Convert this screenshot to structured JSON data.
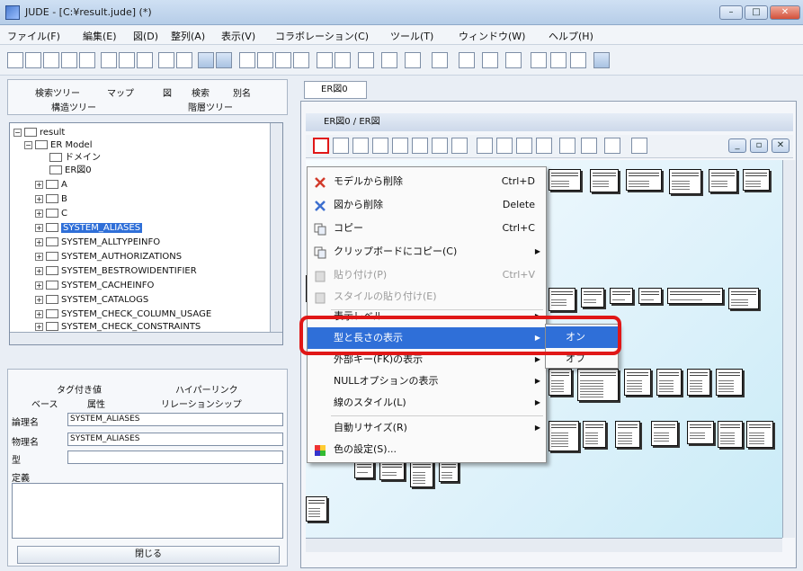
{
  "window": {
    "title": "JUDE - [C:¥result.jude] (*)"
  },
  "menubar": [
    "ファイル(F)",
    "編集(E)",
    "図(D)",
    "整列(A)",
    "表示(V)",
    "コラボレーション(C)",
    "ツール(T)",
    "ウィンドウ(W)",
    "ヘルプ(H)"
  ],
  "left_tabs": {
    "row1": [
      "検索ツリー",
      "マップ",
      "図",
      "検索",
      "別名"
    ],
    "row2": [
      "構造ツリー",
      "階層ツリー"
    ]
  },
  "tree": {
    "root": "result",
    "model": "ER Model",
    "domain": "ドメイン",
    "diagram": "ER図0",
    "items": [
      "A",
      "B",
      "C",
      "SYSTEM_ALIASES",
      "SYSTEM_ALLTYPEINFO",
      "SYSTEM_AUTHORIZATIONS",
      "SYSTEM_BESTROWIDENTIFIER",
      "SYSTEM_CACHEINFO",
      "SYSTEM_CATALOGS",
      "SYSTEM_CHECK_COLUMN_USAGE",
      "SYSTEM_CHECK_CONSTRAINTS"
    ]
  },
  "props": {
    "tabs_row1": [
      "タグ付き値",
      "ハイパーリンク"
    ],
    "tabs_row2": [
      "ベース",
      "属性",
      "リレーションシップ"
    ],
    "logical_name_label": "論理名",
    "logical_name_value": "SYSTEM_ALIASES",
    "physical_name_label": "物理名",
    "physical_name_value": "SYSTEM_ALIASES",
    "type_label": "型",
    "definition_label": "定義",
    "close_label": "閉じる"
  },
  "diagram": {
    "tab_label": "ER図0",
    "inner_title": "ER図0 / ER図"
  },
  "context_menu": [
    {
      "label": "モデルから削除",
      "shortcut": "Ctrl+D",
      "icon": "delete-model-icon"
    },
    {
      "label": "図から削除",
      "shortcut": "Delete",
      "icon": "delete-diagram-icon"
    },
    {
      "label": "コピー",
      "shortcut": "Ctrl+C",
      "icon": "copy-icon"
    },
    {
      "label": "クリップボードにコピー(C)",
      "shortcut": "",
      "icon": "clipboard-icon"
    },
    {
      "label": "貼り付け(P)",
      "shortcut": "Ctrl+V",
      "icon": "paste-icon"
    },
    {
      "label": "スタイルの貼り付け(E)",
      "shortcut": "",
      "icon": "paste-style-icon"
    },
    {
      "label": "表示レベル",
      "shortcut": "",
      "icon": ""
    },
    {
      "label": "型と長さの表示",
      "shortcut": "",
      "icon": ""
    },
    {
      "label": "外部キー(FK)の表示",
      "shortcut": "",
      "icon": ""
    },
    {
      "label": "NULLオプションの表示",
      "shortcut": "",
      "icon": ""
    },
    {
      "label": "線のスタイル(L)",
      "shortcut": "",
      "icon": ""
    },
    {
      "label": "自動リサイズ(R)",
      "shortcut": "",
      "icon": ""
    },
    {
      "label": "色の設定(S)...",
      "shortcut": "",
      "icon": "color-icon"
    }
  ],
  "submenu": [
    "オン",
    "オフ"
  ],
  "colors": {
    "highlight": "#2f6fd8",
    "callout": "#e01717"
  }
}
